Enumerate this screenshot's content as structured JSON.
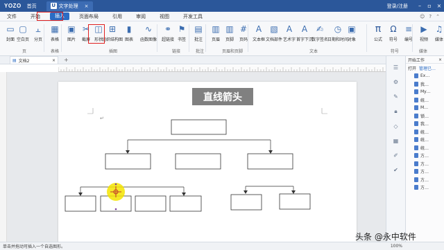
{
  "titlebar": {
    "logo": "YOZO",
    "home": "首页",
    "doc_tab_icon": "U",
    "doc_tab": "文字处理",
    "login": "登录/注册"
  },
  "menu": {
    "items": [
      "文件",
      "开始",
      "插入",
      "页面布局",
      "引用",
      "审阅",
      "视图",
      "开发工具"
    ],
    "active": "插入"
  },
  "ribbon": {
    "buttons": [
      {
        "label": "封面",
        "icon": "cover-icon"
      },
      {
        "label": "空白页",
        "icon": "blank-page-icon"
      },
      {
        "label": "分页",
        "icon": "page-break-icon"
      },
      {
        "label": "表格",
        "icon": "table-icon"
      },
      {
        "label": "图片",
        "icon": "picture-icon"
      },
      {
        "label": "截屏",
        "icon": "screenshot-icon"
      },
      {
        "label": "形状",
        "icon": "shape-icon"
      },
      {
        "label": "组织结构图",
        "icon": "org-chart-icon"
      },
      {
        "label": "图表",
        "icon": "chart-icon"
      },
      {
        "label": "函数图像",
        "icon": "function-graph-icon"
      },
      {
        "label": "超链接",
        "icon": "hyperlink-icon"
      },
      {
        "label": "书签",
        "icon": "bookmark-icon"
      },
      {
        "label": "批注",
        "icon": "comment-icon"
      },
      {
        "label": "页眉",
        "icon": "header-icon"
      },
      {
        "label": "页脚",
        "icon": "footer-icon"
      },
      {
        "label": "页码",
        "icon": "page-number-icon"
      },
      {
        "label": "文本框",
        "icon": "textbox-icon"
      },
      {
        "label": "文档部件",
        "icon": "doc-parts-icon"
      },
      {
        "label": "艺术字",
        "icon": "wordart-icon"
      },
      {
        "label": "首字下沉",
        "icon": "dropcap-icon"
      },
      {
        "label": "数字签名",
        "icon": "signature-icon"
      },
      {
        "label": "日期和时间",
        "icon": "datetime-icon"
      },
      {
        "label": "对象",
        "icon": "object-icon"
      },
      {
        "label": "公式",
        "icon": "formula-icon"
      },
      {
        "label": "符号",
        "icon": "symbol-icon"
      },
      {
        "label": "编号",
        "icon": "numbering-icon"
      },
      {
        "label": "视频",
        "icon": "video-icon"
      },
      {
        "label": "媒体",
        "icon": "media-icon"
      }
    ],
    "groups": [
      "页",
      "表格",
      "插图",
      "链接",
      "批注",
      "页眉和页脚",
      "文本",
      "符号",
      "媒体"
    ]
  },
  "doc": {
    "tab_name": "文档2",
    "title_box": "直线箭头",
    "cursor_mark": "↵"
  },
  "right_panel": {
    "header": "开始工作",
    "open_label": "打开",
    "manage_link": "管理已…",
    "files": [
      "Ex…",
      "我…",
      "My…",
      "统…",
      "M…",
      "锁…",
      "我…",
      "统…",
      "统…",
      "统…",
      "方…",
      "方…",
      "方…",
      "方…",
      "方…"
    ]
  },
  "status": {
    "hint": "单击并拖动可插入一个自选图形。",
    "zoom": "100%"
  },
  "watermark": "头条 @永中软件",
  "colors": {
    "titlebar": "#2b579a",
    "accent": "#2b6cc4",
    "highlight": "#e02020",
    "title_box_bg": "#808080",
    "cursor_glow": "#f5e400"
  }
}
